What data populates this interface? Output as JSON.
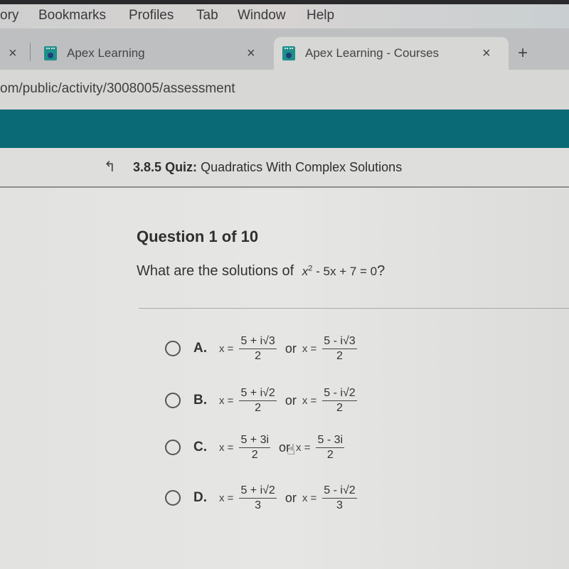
{
  "menubar": {
    "items": [
      "ory",
      "Bookmarks",
      "Profiles",
      "Tab",
      "Window",
      "Help"
    ]
  },
  "tabs": [
    {
      "label": "Apex Learning",
      "active": false
    },
    {
      "label": "Apex Learning - Courses",
      "active": true
    }
  ],
  "tab_close_glyph": "×",
  "new_tab_glyph": "+",
  "address_bar": {
    "url": "om/public/activity/3008005/assessment"
  },
  "colors": {
    "banner": "#0a6a76",
    "favicon": "#1f8f8a"
  },
  "quiz_header": {
    "back_glyph": "↰",
    "number": "3.8.5",
    "type": "Quiz:",
    "title": "Quadratics With Complex Solutions"
  },
  "question": {
    "counter": "Question 1 of 10",
    "prompt": "What are the solutions of",
    "equation_base": "x",
    "equation_exp": "2",
    "equation_rest": " - 5x + 7 = 0",
    "question_mark": "?"
  },
  "options": [
    {
      "letter": "A.",
      "x1_num": "5 + i√3",
      "x1_den": "2",
      "or": "or",
      "x2_num": "5 - i√3",
      "x2_den": "2",
      "selected": false
    },
    {
      "letter": "B.",
      "x1_num": "5 + i√2",
      "x1_den": "2",
      "or": "or",
      "x2_num": "5 - i√2",
      "x2_den": "2",
      "selected": false
    },
    {
      "letter": "C.",
      "x1_num": "5 + 3i",
      "x1_den": "2",
      "or": "or",
      "x2_num": "5 - 3i",
      "x2_den": "2",
      "selected": false
    },
    {
      "letter": "D.",
      "x1_num": "5 + i√2",
      "x1_den": "3",
      "or": "or",
      "x2_num": "5 - i√2",
      "x2_den": "3",
      "selected": false
    }
  ],
  "xeq_label": "x =",
  "cursor_glyph": "☝"
}
